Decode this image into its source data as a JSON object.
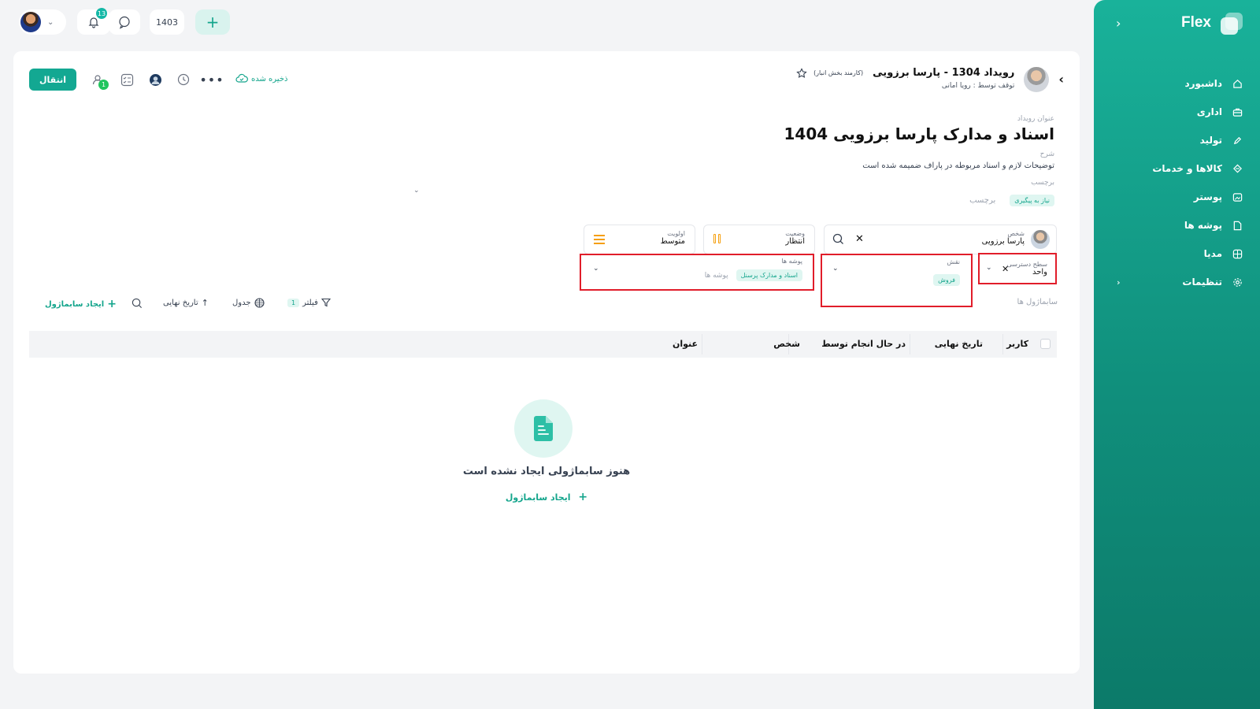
{
  "brand": {
    "name": "Flex"
  },
  "sidebar": {
    "items": [
      {
        "label": "داشبورد",
        "icon": "home-icon"
      },
      {
        "label": "اداری",
        "icon": "briefcase-icon"
      },
      {
        "label": "تولید",
        "icon": "pen-icon"
      },
      {
        "label": "کالاها و خدمات",
        "icon": "box-icon"
      },
      {
        "label": "پوستر",
        "icon": "image-icon"
      },
      {
        "label": "پوشه ها",
        "icon": "folder-icon"
      },
      {
        "label": "مدیا",
        "icon": "globe-icon"
      },
      {
        "label": "تنظیمات",
        "icon": "gear-icon"
      }
    ]
  },
  "topbar": {
    "notifications_count": "13",
    "year": "1403"
  },
  "header": {
    "transfer_label": "انتقال",
    "watchers_count": "1",
    "saved_label": "ذخیره شده",
    "event_title": "رویداد 1304 - پارسا برزویی",
    "event_role": "(کارمند بخش انبار)",
    "event_sub": "توقف توسط : رویا امانی"
  },
  "form": {
    "title_label": "عنوان رویداد",
    "title_value": "اسناد و مدارک پارسا برزویی 1404",
    "desc_label": "شرح",
    "desc_value": "توضیحات لازم و اسناد مربوطه در پاراف ضمیمه شده است",
    "tag_label": "برچسب",
    "tag_chip": "نیاز به پیگیری",
    "tag_placeholder": "برچسب",
    "person_label": "شخص",
    "person_value": "پارسا برزویی",
    "status_label": "وضعیت",
    "status_value": "انتظار",
    "priority_label": "اولویت",
    "priority_value": "متوسط",
    "access_label": "سطح دسترسی",
    "access_value": "واحد",
    "role_label": "نقش",
    "role_chip": "فروش",
    "folders_label": "پوشه ها",
    "folders_chip": "اسناد و مدارک پرسنل",
    "folders_placeholder": "پوشه ها"
  },
  "subtasks": {
    "section_label": "سابماژول ها",
    "create_label": "ایجاد سابماژول",
    "due_sort_label": "تاریخ نهایی",
    "table_view_label": "جدول",
    "filter_label": "فیلتر",
    "filter_count": "1",
    "columns": [
      "کاربر",
      "تاریخ نهایی",
      "در حال انجام توسط",
      "شخص",
      "عنوان"
    ],
    "empty_text": "هنوز سابماژولی ایجاد نشده است",
    "empty_create": "ایجاد سابماژول"
  }
}
